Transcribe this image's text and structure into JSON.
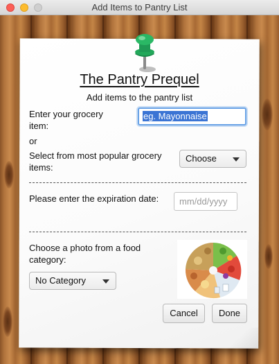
{
  "window": {
    "title": "Add Items to Pantry List"
  },
  "header": {
    "title": "The Pantry Prequel",
    "subtitle": "Add items to the pantry list"
  },
  "form": {
    "item_label": "Enter your grocery item:",
    "item_input_value": "eg. Mayonnaise",
    "or_label": "or",
    "popular_label": "Select from most popular grocery items:",
    "popular_select_value": "Choose",
    "divider_text": "-----------------------------------------------------",
    "expiration_label": "Please enter the expiration date:",
    "expiration_placeholder": "mm/dd/yyyy",
    "photo_label": "Choose a photo from a food category:",
    "category_select_value": "No Category"
  },
  "buttons": {
    "cancel": "Cancel",
    "done": "Done"
  },
  "colors": {
    "focus_ring": "#6aa3e6",
    "selection": "#3b74d4",
    "pin": "#1f9a55"
  }
}
